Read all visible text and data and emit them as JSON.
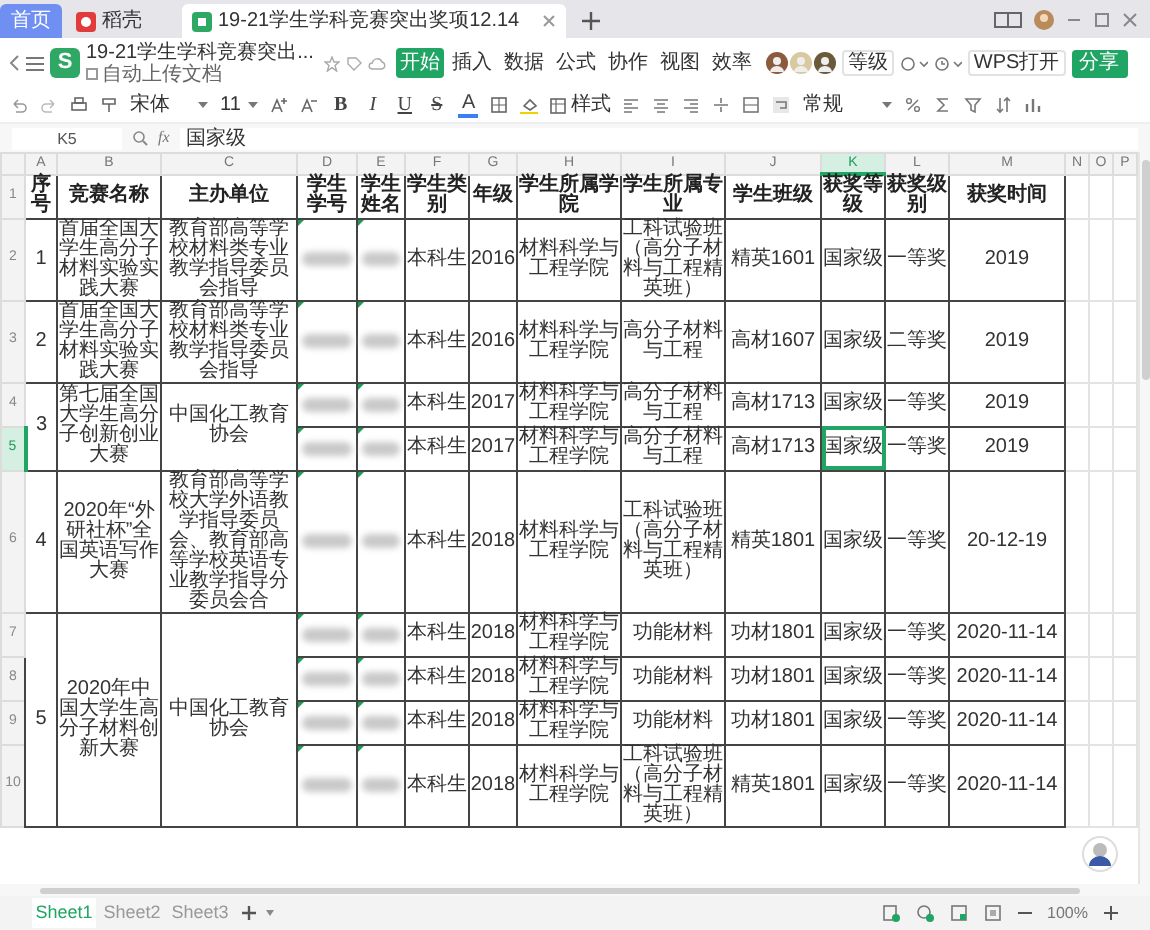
{
  "tabs": [
    {
      "label": "首页",
      "kind": "home",
      "selected": false
    },
    {
      "label": "稻壳",
      "kind": "docer",
      "selected": false
    },
    {
      "label": "19-21学生学科竞赛突出奖项12.14",
      "kind": "sheet",
      "selected": true
    }
  ],
  "document": {
    "logo": "S",
    "title": "19-21学生学科竞赛突出...",
    "autosave": "自动上传文档"
  },
  "menu": [
    {
      "label": "开始",
      "selected": true
    },
    {
      "label": "插入",
      "selected": false
    },
    {
      "label": "数据",
      "selected": false
    },
    {
      "label": "公式",
      "selected": false
    },
    {
      "label": "协作",
      "selected": false
    },
    {
      "label": "视图",
      "selected": false
    },
    {
      "label": "效率",
      "selected": false
    }
  ],
  "header_buttons": {
    "level": "等级",
    "open_in": "WPS打开",
    "share": "分享"
  },
  "toolbar": {
    "font": "宋体",
    "size": "11",
    "format_buttons": [
      "B",
      "I",
      "U",
      "S"
    ],
    "font_color": "A",
    "cell_style": "样式",
    "number_format": "常规"
  },
  "formula_bar": {
    "cell": "K5",
    "fx": "fx",
    "value": "国家级"
  },
  "columns": [
    {
      "letter": "A",
      "selected": false
    },
    {
      "letter": "B",
      "selected": false
    },
    {
      "letter": "C",
      "selected": false
    },
    {
      "letter": "D",
      "selected": false
    },
    {
      "letter": "E",
      "selected": false
    },
    {
      "letter": "F",
      "selected": false
    },
    {
      "letter": "G",
      "selected": false
    },
    {
      "letter": "H",
      "selected": false
    },
    {
      "letter": "I",
      "selected": false
    },
    {
      "letter": "J",
      "selected": false
    },
    {
      "letter": "K",
      "selected": true
    },
    {
      "letter": "L",
      "selected": false
    },
    {
      "letter": "M",
      "selected": false
    },
    {
      "letter": "N",
      "selected": false
    },
    {
      "letter": "O",
      "selected": false
    },
    {
      "letter": "P",
      "selected": false
    }
  ],
  "header_row": {
    "row_number": "1",
    "cells": [
      "序号",
      "竞赛名称",
      "主办单位",
      "学生学号",
      "学生姓名",
      "学生类别",
      "年级",
      "学生所属学院",
      "学生所属专业",
      "学生班级",
      "获奖等级",
      "获奖级别",
      "获奖时间"
    ]
  },
  "entries": [
    {
      "seq": "1",
      "competition": "首届全国大学生高分子材料实验实践大赛",
      "organizer": "教育部高等学校材料类专业教学指导委员会指导",
      "students": [
        {
          "row_number": "2",
          "selected": false,
          "redacted": true,
          "category": "本科生",
          "grade": "2016",
          "college": "材料科学与工程学院",
          "major": "工科试验班（高分子材料与工程精英班）",
          "class": "精英1601",
          "award_level": "国家级",
          "award_grade": "一等奖",
          "award_date": "2019"
        }
      ]
    },
    {
      "seq": "2",
      "competition": "首届全国大学生高分子材料实验实践大赛",
      "organizer": "教育部高等学校材料类专业教学指导委员会指导",
      "students": [
        {
          "row_number": "3",
          "selected": false,
          "redacted": true,
          "category": "本科生",
          "grade": "2016",
          "college": "材料科学与工程学院",
          "major": "高分子材料与工程",
          "class": "高材1607",
          "award_level": "国家级",
          "award_grade": "二等奖",
          "award_date": "2019"
        }
      ]
    },
    {
      "seq": "3",
      "competition": "第七届全国大学生高分子创新创业大赛",
      "organizer": "中国化工教育协会",
      "students": [
        {
          "row_number": "4",
          "selected": false,
          "redacted": true,
          "category": "本科生",
          "grade": "2017",
          "college": "材料科学与工程学院",
          "major": "高分子材料与工程",
          "class": "高材1713",
          "award_level": "国家级",
          "award_grade": "一等奖",
          "award_date": "2019"
        },
        {
          "row_number": "5",
          "selected": true,
          "redacted": true,
          "category": "本科生",
          "grade": "2017",
          "college": "材料科学与工程学院",
          "major": "高分子材料与工程",
          "class": "高材1713",
          "award_level": "国家级",
          "award_grade": "一等奖",
          "award_date": "2019"
        }
      ]
    },
    {
      "seq": "4",
      "competition": "2020年“外研社杯”全国英语写作大赛",
      "organizer": "教育部高等学校大学外语教学指导委员会、教育部高等学校英语专业教学指导分委员会合",
      "students": [
        {
          "row_number": "6",
          "selected": false,
          "redacted": true,
          "category": "本科生",
          "grade": "2018",
          "college": "材料科学与工程学院",
          "major": "工科试验班（高分子材料与工程精英班）",
          "class": "精英1801",
          "award_level": "国家级",
          "award_grade": "一等奖",
          "award_date": "20-12-19"
        }
      ]
    },
    {
      "seq": "5",
      "competition": "2020年中国大学生高分子材料创新大赛",
      "organizer": "中国化工教育协会",
      "students": [
        {
          "row_number": "7",
          "selected": false,
          "redacted": true,
          "category": "本科生",
          "grade": "2018",
          "college": "材料科学与工程学院",
          "major": "功能材料",
          "class": "功材1801",
          "award_level": "国家级",
          "award_grade": "一等奖",
          "award_date": "2020-11-14"
        },
        {
          "row_number": "8",
          "selected": false,
          "redacted": true,
          "category": "本科生",
          "grade": "2018",
          "college": "材料科学与工程学院",
          "major": "功能材料",
          "class": "功材1801",
          "award_level": "国家级",
          "award_grade": "一等奖",
          "award_date": "2020-11-14"
        },
        {
          "row_number": "9",
          "selected": false,
          "redacted": true,
          "category": "本科生",
          "grade": "2018",
          "college": "材料科学与工程学院",
          "major": "功能材料",
          "class": "功材1801",
          "award_level": "国家级",
          "award_grade": "一等奖",
          "award_date": "2020-11-14"
        },
        {
          "row_number": "10",
          "selected": false,
          "redacted": true,
          "category": "本科生",
          "grade": "2018",
          "college": "材料科学与工程学院",
          "major": "工科试验班（高分子材料与工程精英班）",
          "class": "精英1801",
          "award_level": "国家级",
          "award_grade": "一等奖",
          "award_date": "2020-11-14"
        }
      ]
    }
  ],
  "sheets": [
    {
      "label": "Sheet1",
      "selected": true
    },
    {
      "label": "Sheet2",
      "selected": false
    },
    {
      "label": "Sheet3",
      "selected": false
    }
  ],
  "zoom": "100%"
}
